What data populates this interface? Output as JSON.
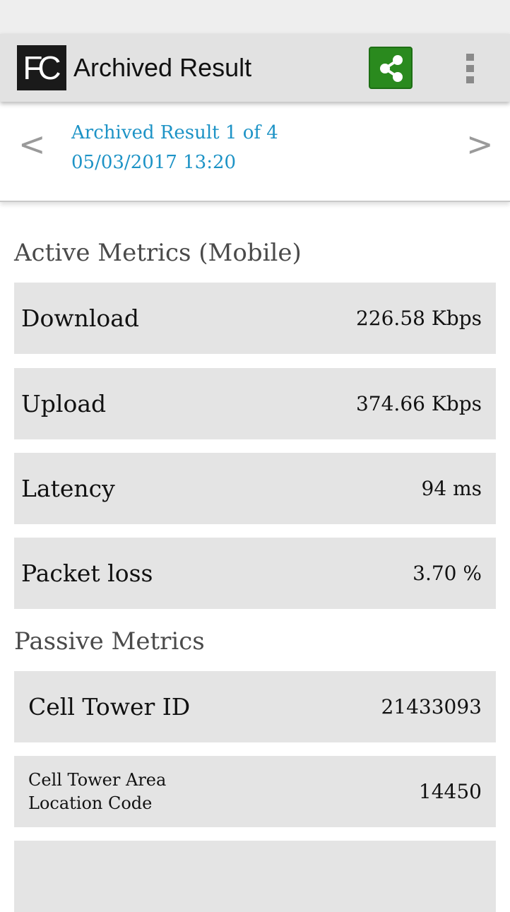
{
  "app": {
    "logo_text": "FC",
    "title": "Archived Result"
  },
  "toolbar": {
    "share_icon": "share-icon",
    "overflow_icon": "overflow-menu-icon",
    "share_color": "#2a8a1e"
  },
  "navigation": {
    "prev_glyph": "<",
    "next_glyph": ">",
    "result_label": "Archived Result 1 of 4",
    "timestamp": "05/03/2017 13:20",
    "link_color": "#1d93c6"
  },
  "active_metrics": {
    "heading": "Active Metrics (Mobile)",
    "rows": [
      {
        "label": "Download",
        "value": "226.58 Kbps"
      },
      {
        "label": "Upload",
        "value": "374.66 Kbps"
      },
      {
        "label": "Latency",
        "value": "94 ms"
      },
      {
        "label": "Packet loss",
        "value": "3.70 %"
      }
    ]
  },
  "passive_metrics": {
    "heading": "Passive Metrics",
    "rows": [
      {
        "label": "Cell Tower ID",
        "value": "21433093"
      },
      {
        "label_line1": "Cell Tower Area",
        "label_line2": "Location Code",
        "value": "14450"
      }
    ]
  }
}
